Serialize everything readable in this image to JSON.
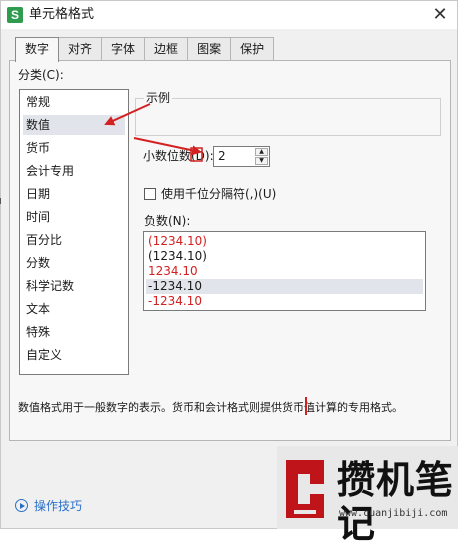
{
  "window": {
    "title": "单元格格式",
    "app_icon": "S",
    "close_symbol": "✕"
  },
  "tabs": [
    {
      "label": "数字",
      "active": true
    },
    {
      "label": "对齐",
      "active": false
    },
    {
      "label": "字体",
      "active": false
    },
    {
      "label": "边框",
      "active": false
    },
    {
      "label": "图案",
      "active": false
    },
    {
      "label": "保护",
      "active": false
    }
  ],
  "category": {
    "label": "分类(C):",
    "items": [
      "常规",
      "数值",
      "货币",
      "会计专用",
      "日期",
      "时间",
      "百分比",
      "分数",
      "科学记数",
      "文本",
      "特殊",
      "自定义"
    ],
    "selected": "数值"
  },
  "sample": {
    "label": "示例",
    "value": ""
  },
  "decimal": {
    "label": "小数位数(D):",
    "value": "2"
  },
  "thousands": {
    "label": "使用千位分隔符(,)(U)",
    "checked": false
  },
  "negative": {
    "label": "负数(N):",
    "items": [
      {
        "text": "(1234.10)",
        "red": true
      },
      {
        "text": "(1234.10)",
        "red": false
      },
      {
        "text": "1234.10",
        "red": true
      },
      {
        "text": "-1234.10",
        "red": false
      },
      {
        "text": "-1234.10",
        "red": true
      }
    ],
    "selected_index": 3
  },
  "description": "数值格式用于一般数字的表示。货币和会计格式则提供货币值计算的专用格式。",
  "tips_link": "操作技巧",
  "watermark": {
    "text": "攒机笔记",
    "url": "www.cuanjibiji.com"
  },
  "colors": {
    "accent_red": "#d32020",
    "link_blue": "#2a6fc9",
    "selection": "#e1e4ea",
    "app_green": "#2e9b4e"
  }
}
